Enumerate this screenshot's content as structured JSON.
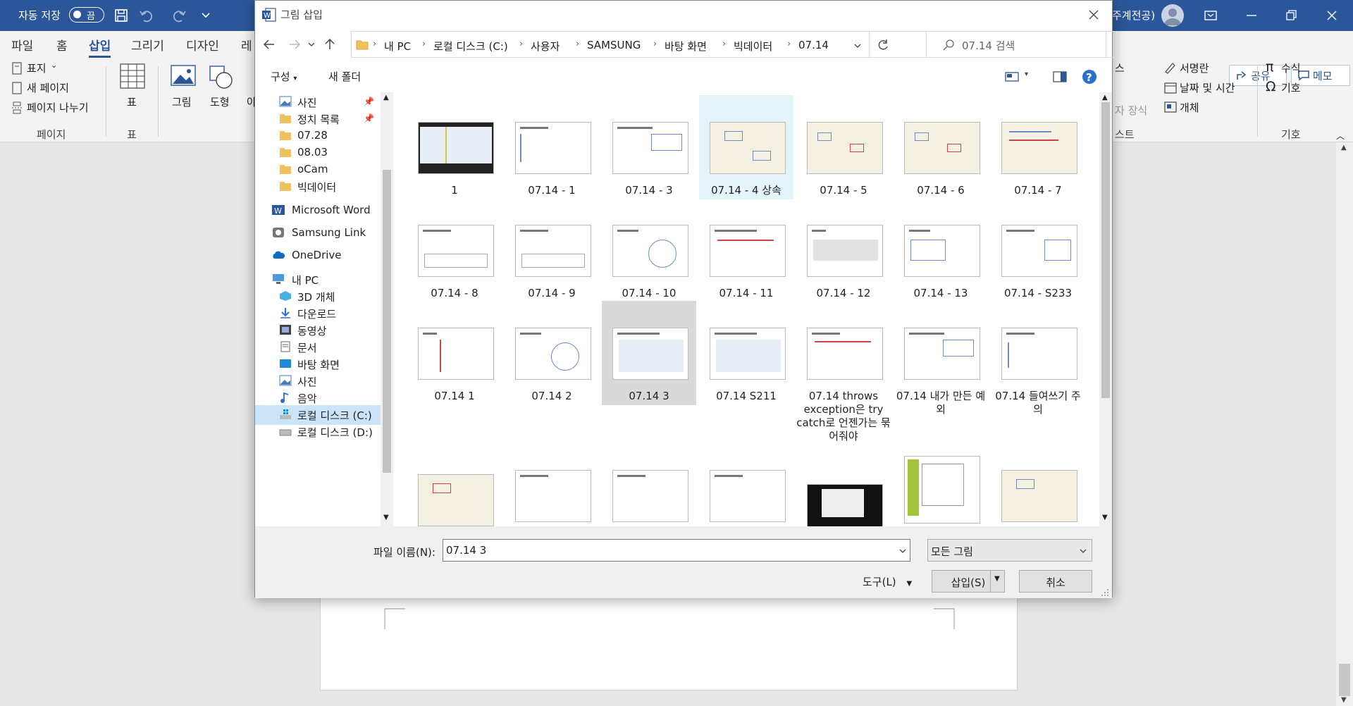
{
  "app": {
    "autosave_label": "자동 저장",
    "autosave_state": "끔",
    "user_name_fragment": "주계전공)"
  },
  "ribbon": {
    "tabs": [
      "파일",
      "홈",
      "삽입",
      "그리기",
      "디자인",
      "레"
    ],
    "active_tab": "삽입",
    "share_label": "공유",
    "comment_label": "메모",
    "pages": {
      "cover": "표지",
      "new_page": "새 페이지",
      "page_break": "페이지 나누기",
      "group": "페이지"
    },
    "table": {
      "label": "표",
      "group": "표"
    },
    "illustrations": {
      "picture": "그림",
      "shapes": "도형",
      "partial": "아"
    },
    "right": {
      "partial_1": "스",
      "partial_2": "자 장식",
      "partial_3": "스트",
      "signature": "서명란",
      "datetime": "날짜 및 시간",
      "object": "개체",
      "equation": "수식",
      "symbol": "기호",
      "group_symbols": "기호"
    }
  },
  "dialog": {
    "title": "그림 삽입",
    "breadcrumbs": [
      "내 PC",
      "로컬 디스크 (C:)",
      "사용자",
      "SAMSUNG",
      "바탕 화면",
      "빅데이터",
      "07.14"
    ],
    "search_placeholder": "07.14 검색",
    "organize": "구성",
    "new_folder": "새 폴더",
    "nav": {
      "quick": [
        "사진",
        "정치 목록",
        "07.28",
        "08.03",
        "oCam",
        "빅데이터"
      ],
      "apps": [
        "Microsoft Word",
        "Samsung Link",
        "OneDrive"
      ],
      "pc": "내 PC",
      "pc_items": [
        "3D 개체",
        "다운로드",
        "동영상",
        "문서",
        "바탕 화면",
        "사진",
        "음악",
        "로컬 디스크 (C:)",
        "로컬 디스크 (D:)"
      ]
    },
    "files": [
      [
        "1",
        "07.14 - 1",
        "07.14 - 3",
        "07.14 - 4 상속",
        "07.14 - 5",
        "07.14 - 6",
        "07.14 - 7"
      ],
      [
        "07.14 - 8",
        "07.14 - 9",
        "07.14 - 10",
        "07.14 - 11",
        "07.14 - 12",
        "07.14 - 13",
        "07.14 - S233"
      ],
      [
        "07.14 1",
        "07.14 2",
        "07.14 3",
        "07.14 S211",
        "07.14 throws exception은 try catch로 언젠가는 묶어줘야",
        "07.14 내가 만든 예외",
        "07.14 들여쓰기 주의"
      ]
    ],
    "filename_label": "파일 이름(N):",
    "filename_value": "07.14 3",
    "filetype": "모든 그림",
    "tools": "도구(L)",
    "insert": "삽입(S)",
    "cancel": "취소"
  }
}
